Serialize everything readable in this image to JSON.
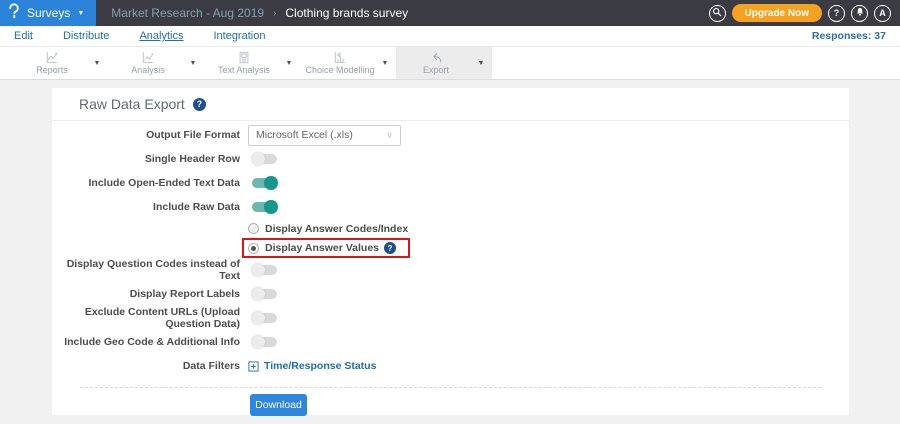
{
  "topbar": {
    "product_label": "Surveys",
    "breadcrumb_parent": "Market Research - Aug 2019",
    "breadcrumb_separator": "›",
    "breadcrumb_current": "Clothing brands survey",
    "upgrade_label": "Upgrade Now",
    "help_label": "?",
    "avatar_label": "A",
    "icons": [
      "questionpro-logo-icon",
      "search-icon",
      "bell-icon"
    ]
  },
  "nav": {
    "items": [
      {
        "label": "Edit",
        "active": false
      },
      {
        "label": "Distribute",
        "active": false
      },
      {
        "label": "Analytics",
        "active": true
      },
      {
        "label": "Integration",
        "active": false
      }
    ],
    "responses": "Responses: 37"
  },
  "toolbar": {
    "tabs": [
      {
        "label": "Reports",
        "icon": "line-chart-icon",
        "active": false
      },
      {
        "label": "Analysis",
        "icon": "scatter-chart-icon",
        "active": false
      },
      {
        "label": "Text Analysis",
        "icon": "document-icon",
        "active": false
      },
      {
        "label": "Choice Modelling",
        "icon": "bar-chart-icon",
        "active": false
      },
      {
        "label": "Export",
        "icon": "export-arrow-icon",
        "active": true
      }
    ]
  },
  "main": {
    "title": "Raw Data Export",
    "help_label": "?",
    "form": {
      "output_file_format": {
        "label": "Output File Format",
        "value": "Microsoft Excel (.xls)"
      },
      "single_header_row": {
        "label": "Single Header Row",
        "state": "off"
      },
      "include_open_ended": {
        "label": "Include Open-Ended Text Data",
        "state": "on"
      },
      "include_raw_data": {
        "label": "Include Raw Data",
        "state": "on"
      },
      "display_answer_codes": {
        "label": "Display Answer Codes/Index",
        "selected": false
      },
      "display_answer_values": {
        "label": "Display Answer Values",
        "selected": true,
        "highlighted": true,
        "help_label": "?"
      },
      "display_question_codes": {
        "label": "Display Question Codes instead of Text",
        "state": "off"
      },
      "display_report_labels": {
        "label": "Display Report Labels",
        "state": "off"
      },
      "exclude_content_urls": {
        "label": "Exclude Content URLs (Upload Question Data)",
        "state": "off"
      },
      "include_geo_code": {
        "label": "Include Geo Code & Additional Info",
        "state": "off"
      },
      "data_filters": {
        "label": "Data Filters",
        "link": "Time/Response Status"
      }
    },
    "download_label": "Download"
  },
  "colors": {
    "header_dark": "#3b3b44",
    "logo_blue": "#2b84d9",
    "upgrade_orange": "#f6a21e",
    "link_blue": "#1e6fb0",
    "accent_blue": "#2e86de",
    "toggle_on_teal": "#17968b",
    "highlight_red": "#de1414",
    "help_navy": "#1d4f8f"
  }
}
